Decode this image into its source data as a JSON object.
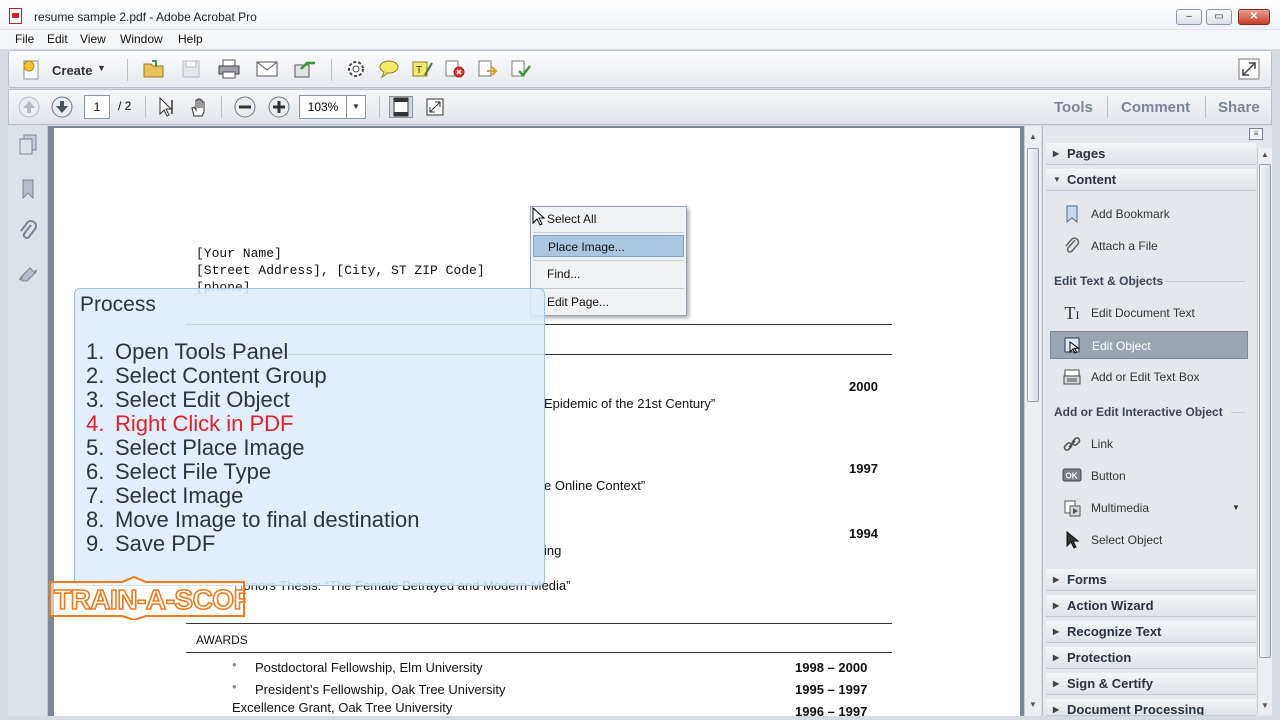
{
  "window": {
    "title": "resume sample 2.pdf - Adobe Acrobat Pro",
    "minimize": "–",
    "maximize": "▭",
    "close": "✕"
  },
  "menu": [
    "File",
    "Edit",
    "View",
    "Window",
    "Help"
  ],
  "toolbar": {
    "create_label": "Create",
    "icons": [
      "open-folder-icon",
      "save-icon",
      "print-icon",
      "email-icon",
      "share-icon",
      "settings-gear-icon",
      "comment-bubble-icon",
      "highlight-icon",
      "stop-icon",
      "export-icon",
      "review-icon"
    ]
  },
  "nav": {
    "current_page": "1",
    "total_pages": "/ 2",
    "zoom": "103%",
    "tabs": [
      "Tools",
      "Comment",
      "Share"
    ]
  },
  "document": {
    "header_lines": [
      "[Your Name]",
      "[Street Address], [City, ST  ZIP Code]",
      "[phone]"
    ],
    "entries": [
      {
        "year": "2000",
        "text": "Epidemic of the 21st Century”"
      },
      {
        "year": "1997",
        "text": "e Online Context”"
      },
      {
        "year": "1994",
        "text": "ing"
      },
      {
        "year": "",
        "text": "Honors Thesis: “The Female Betrayed and Modern Media”"
      }
    ],
    "awards_heading": "AWARDS",
    "awards": [
      {
        "text": "Postdoctoral Fellowship, Elm University",
        "years": "1998 – 2000"
      },
      {
        "text": "President’s Fellowship, Oak Tree University",
        "years": "1995 – 1997"
      },
      {
        "text": "Excellence Grant, Oak Tree University",
        "years": "1996 – 1997"
      }
    ]
  },
  "context_menu": {
    "items": [
      "Select All",
      "Place Image...",
      "Find...",
      "Edit Page..."
    ],
    "highlighted": "Place Image..."
  },
  "process": {
    "title": "Process",
    "steps": [
      {
        "n": "1.",
        "text": "Open Tools Panel"
      },
      {
        "n": "2.",
        "text": "Select Content Group"
      },
      {
        "n": "3.",
        "text": "Select Edit Object"
      },
      {
        "n": "4.",
        "text": "Right Click in PDF"
      },
      {
        "n": "5.",
        "text": "Select Place Image"
      },
      {
        "n": "6.",
        "text": "Select File Type"
      },
      {
        "n": "7.",
        "text": "Select Image"
      },
      {
        "n": "8.",
        "text": "Move Image to final destination"
      },
      {
        "n": "9.",
        "text": "Save PDF"
      }
    ],
    "active_step": "4.",
    "active_color": "#e0202a"
  },
  "logo_text": "TRAIN-A-SCOPE",
  "tools_panel": {
    "sections_top": [
      "Pages",
      "Content"
    ],
    "content_items": [
      {
        "label": "Add Bookmark",
        "icon": "bookmark-icon"
      },
      {
        "label": "Attach a File",
        "icon": "paperclip-icon"
      }
    ],
    "edit_text_heading": "Edit Text & Objects",
    "edit_items": [
      {
        "label": "Edit Document Text",
        "icon": "text-cursor-icon"
      },
      {
        "label": "Edit Object",
        "icon": "edit-object-icon"
      },
      {
        "label": "Add or Edit Text Box",
        "icon": "typewriter-icon"
      }
    ],
    "interactive_heading": "Add or Edit Interactive Object",
    "interactive_items": [
      {
        "label": "Link",
        "icon": "link-icon"
      },
      {
        "label": "Button",
        "icon": "ok-button-icon"
      },
      {
        "label": "Multimedia",
        "icon": "multimedia-icon"
      },
      {
        "label": "Select Object",
        "icon": "arrow-cursor-icon"
      }
    ],
    "sections_bottom": [
      "Forms",
      "Action Wizard",
      "Recognize Text",
      "Protection",
      "Sign & Certify",
      "Document Processing"
    ],
    "selected": "Edit Object"
  }
}
